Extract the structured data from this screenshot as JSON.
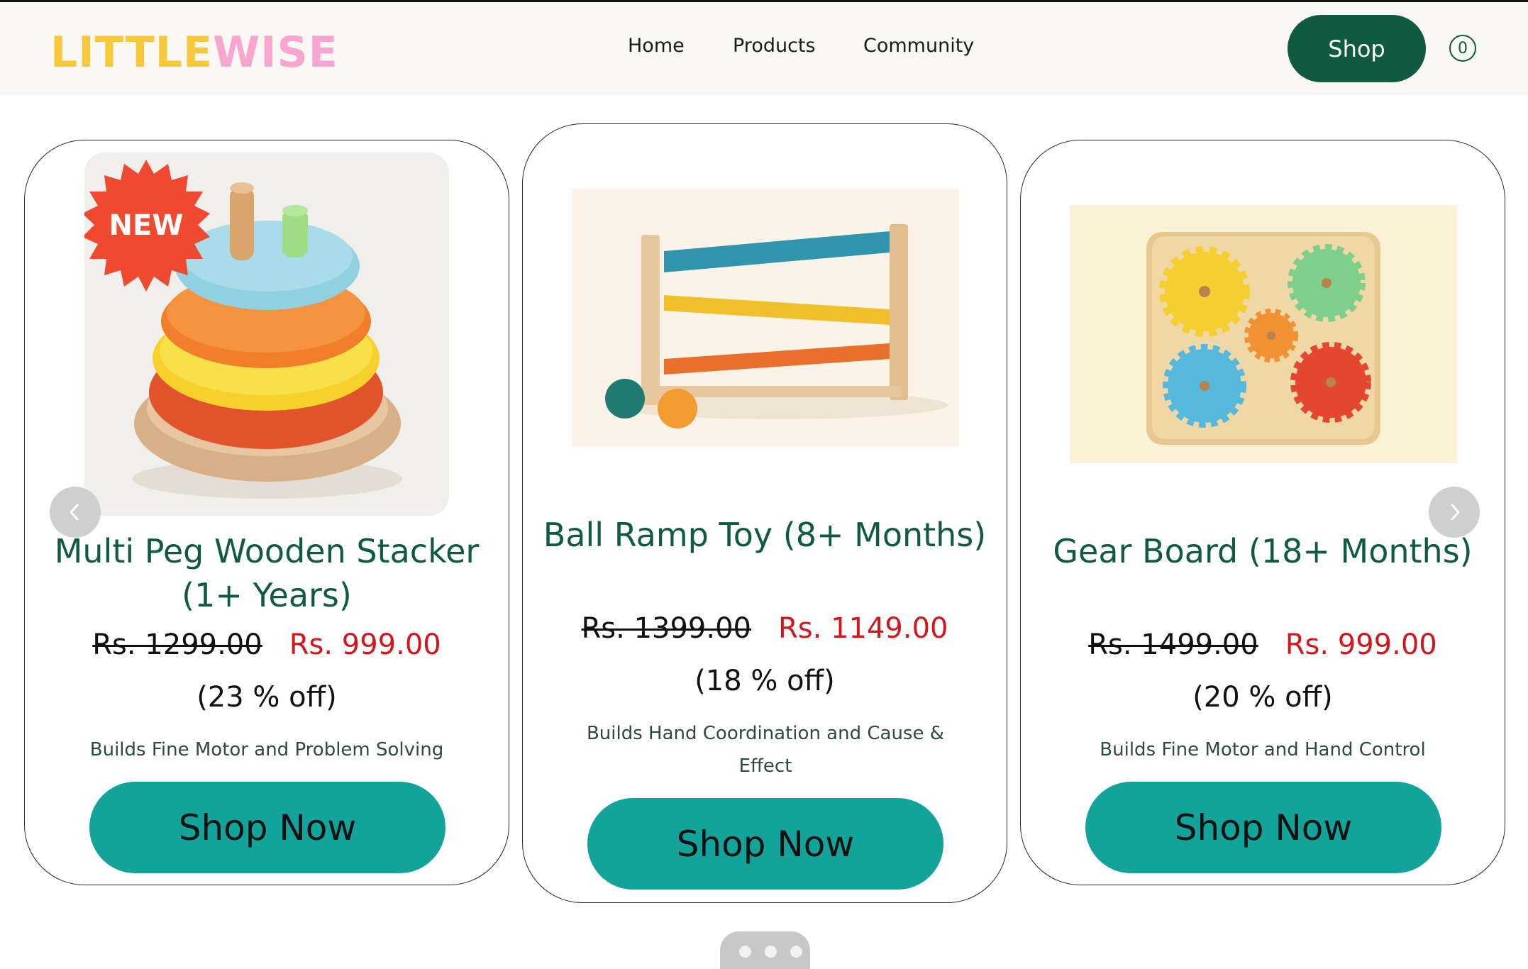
{
  "brand": {
    "logo_part1": "LITTLE",
    "logo_part2": "WISE"
  },
  "nav": {
    "items": [
      "Home",
      "Products",
      "Community"
    ],
    "shop_label": "Shop",
    "cart_count": "0"
  },
  "products": [
    {
      "title": "Multi Peg Wooden Stacker (1+ Years)",
      "badge": "NEW",
      "old_price": "Rs. 1299.00",
      "new_price": "Rs. 999.00",
      "discount": "(23 % off)",
      "benefit": "Builds Fine Motor and Problem Solving",
      "cta": "Shop Now"
    },
    {
      "title": "Ball Ramp Toy (8+ Months)",
      "old_price": "Rs. 1399.00",
      "new_price": "Rs. 1149.00",
      "discount": "(18 % off)",
      "benefit": "Builds Hand Coordination and Cause & Effect",
      "cta": "Shop Now"
    },
    {
      "title": "Gear Board (18+ Months)",
      "old_price": "Rs. 1499.00",
      "new_price": "Rs. 999.00",
      "discount": "(20 % off)",
      "benefit": "Builds Fine Motor and Hand Control",
      "cta": "Shop Now"
    }
  ],
  "carousel": {
    "page_count": 3
  },
  "colors": {
    "brand_green": "#0f5a41",
    "teal": "#12a39a",
    "sale_red": "#d3161b",
    "logo_yellow": "#f6c83a",
    "logo_pink": "#f7a6cf"
  }
}
